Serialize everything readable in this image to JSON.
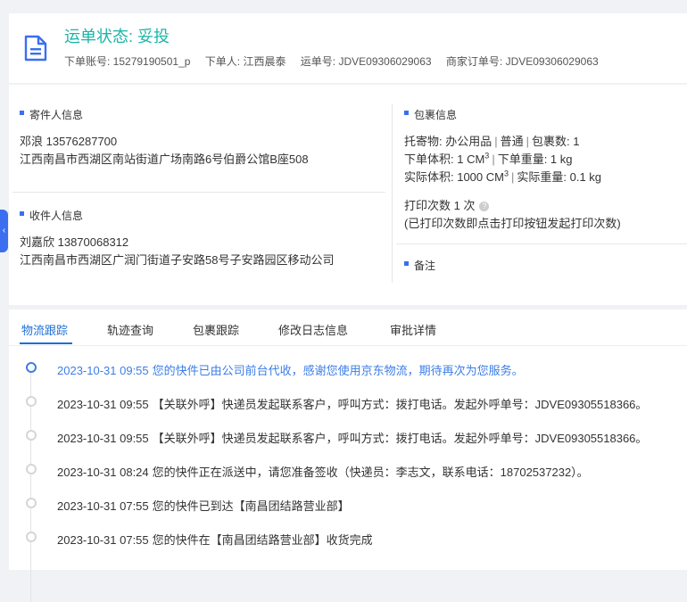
{
  "header": {
    "status": "运单状态: 妥投",
    "order_account": "下单账号: 15279190501_p",
    "orderer": "下单人: 江西晨泰",
    "waybill": "运单号: JDVE09306029063",
    "merchant_order": "商家订单号: JDVE09306029063"
  },
  "sender": {
    "title": "寄件人信息",
    "name_phone": "邓浪    13576287700",
    "address": "江西南昌市西湖区南站街道广场南路6号伯爵公馆B座508"
  },
  "receiver": {
    "title": "收件人信息",
    "name_phone": "刘嘉欣    13870068312",
    "address": "江西南昌市西湖区广润门街道子安路58号子安路园区移动公司"
  },
  "package": {
    "title": "包裹信息",
    "goods_label": "托寄物: ",
    "goods_value": "办公用品",
    "service": "普通",
    "count": "包裹数:  1",
    "order_volume": "下单体积:    1 CM",
    "order_weight": "下单重量:    1 kg",
    "actual_volume": "实际体积:    1000 CM",
    "actual_weight": "实际重量:    0.1 kg",
    "volume_exp": "3",
    "print_count": "打印次数    1 次",
    "print_help": "?",
    "print_note": "(已打印次数即点击打印按钮发起打印次数)",
    "remark_title": "备注"
  },
  "tabs": [
    "物流跟踪",
    "轨迹查询",
    "包裹跟踪",
    "修改日志信息",
    "审批详情"
  ],
  "events": [
    {
      "time": "2023-10-31 09:55",
      "text": "您的快件已由公司前台代收，感谢您使用京东物流，期待再次为您服务。"
    },
    {
      "time": "2023-10-31 09:55",
      "text": "【关联外呼】快递员发起联系客户，呼叫方式：拨打电话。发起外呼单号：JDVE09305518366。"
    },
    {
      "time": "2023-10-31 09:55",
      "text": "【关联外呼】快递员发起联系客户，呼叫方式：拨打电话。发起外呼单号：JDVE09305518366。"
    },
    {
      "time": "2023-10-31 08:24",
      "text": "您的快件正在派送中，请您准备签收（快递员：李志文，联系电话：18702537232）。"
    },
    {
      "time": "2023-10-31 07:55",
      "text": "您的快件已到达【南昌团结路营业部】"
    },
    {
      "time": "2023-10-31 07:55",
      "text": "您的快件在【南昌团结路营业部】收货完成"
    }
  ],
  "colors": {
    "status": "#19b5a8",
    "accent": "#1d6fd6",
    "current_event": "#3b7de8"
  }
}
